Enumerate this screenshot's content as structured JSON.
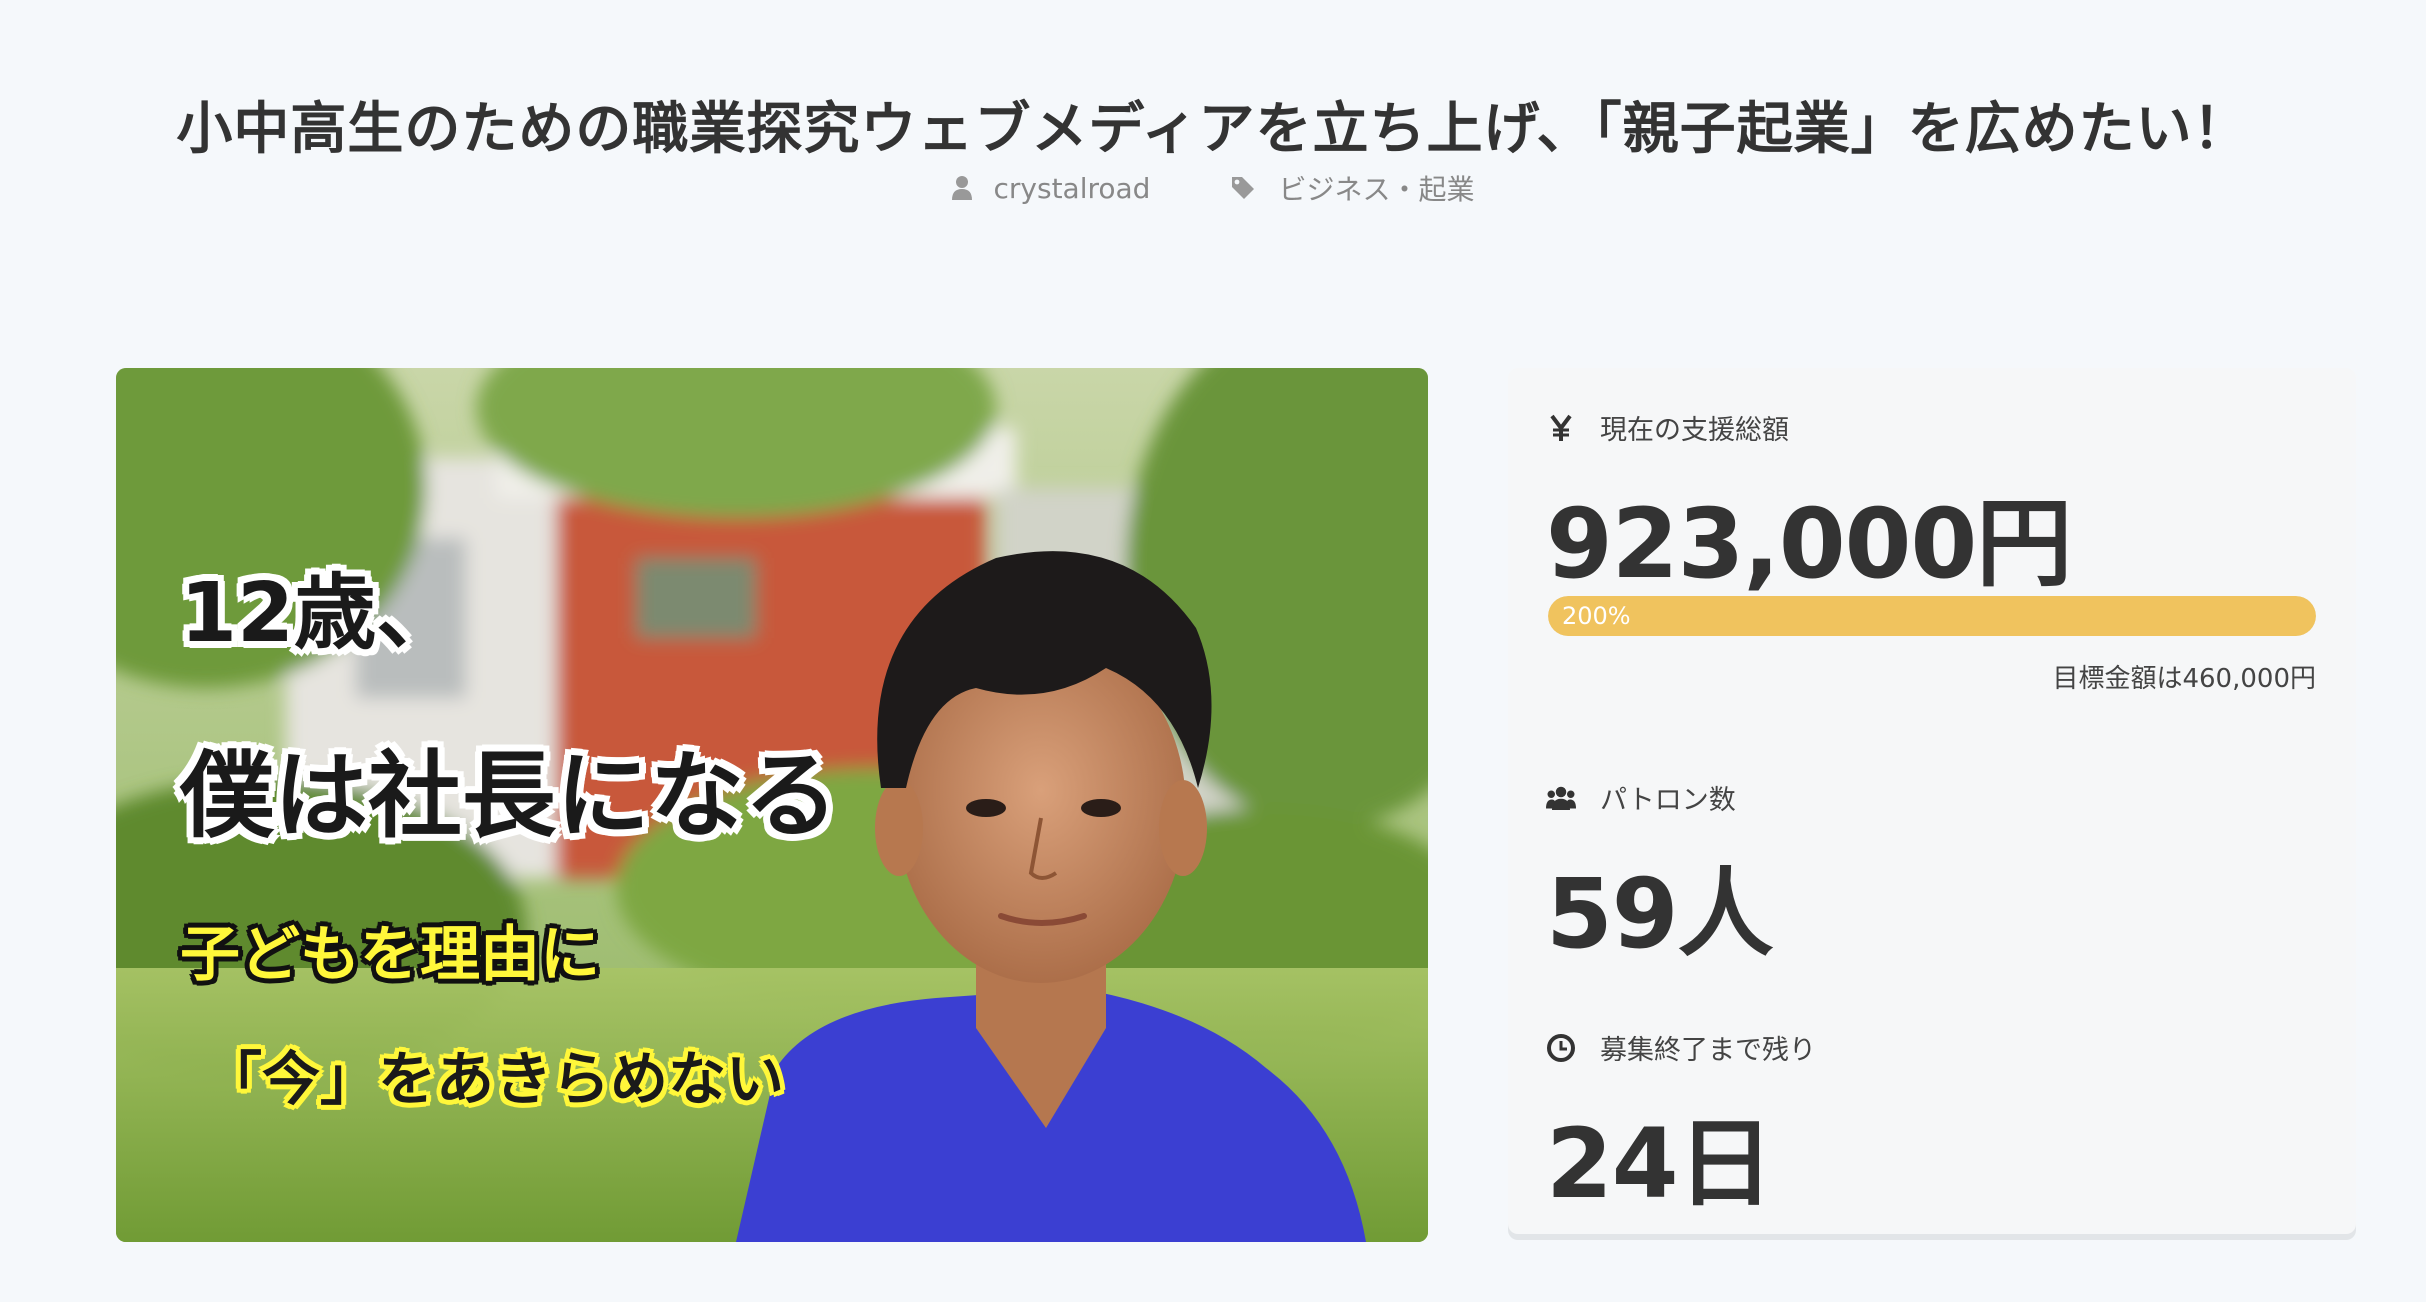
{
  "header": {
    "title": "小中高生のための職業探究ウェブメディアを立ち上げ、「親子起業」を広めたい！",
    "author": "crystalroad",
    "category": "ビジネス・起業",
    "author_icon": "user-icon",
    "category_icon": "tag-icon"
  },
  "hero": {
    "catch_line1": "12歳、",
    "catch_line2": "僕は社長になる",
    "catch_line3": "子どもを理由に",
    "catch_line4": "「今」をあきらめない"
  },
  "stats": {
    "funding_label": "現在の支援総額",
    "funding_icon": "yen-icon",
    "funding_amount": "923,000円",
    "progress_text": "200%",
    "progress_ratio": 2.0,
    "goal_text": "目標金額は460,000円",
    "patron_label": "パトロン数",
    "patron_icon": "users-icon",
    "patron_count": "59人",
    "remaining_label": "募集終了まで残り",
    "remaining_icon": "clock-icon",
    "remaining_days": "24日"
  },
  "colors": {
    "background": "#f5f8fb",
    "progress": "#f0c35e",
    "text": "#333333"
  }
}
